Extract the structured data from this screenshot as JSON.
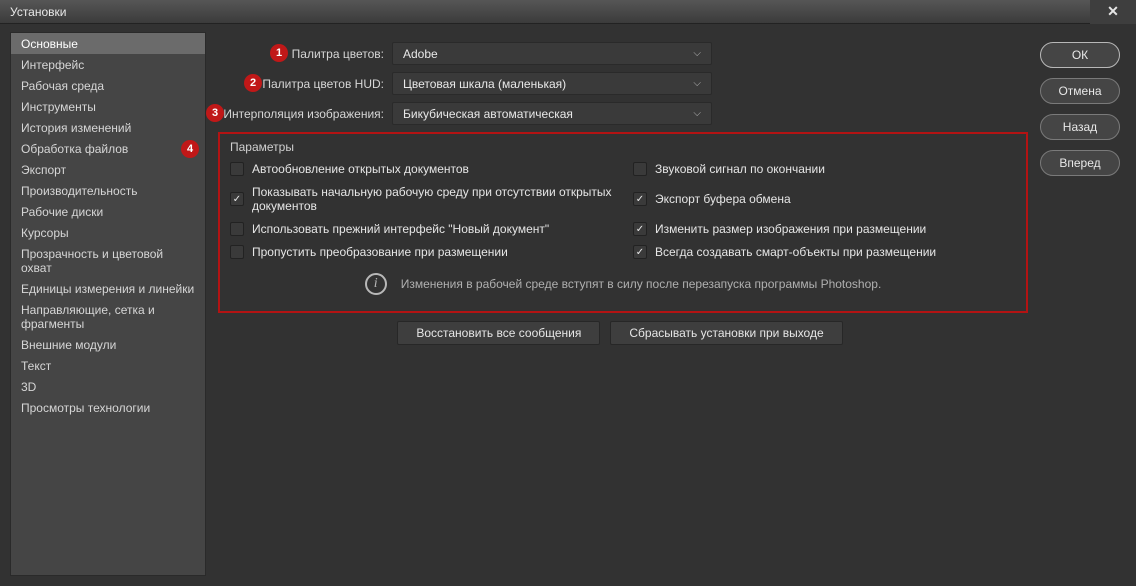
{
  "window": {
    "title": "Установки"
  },
  "sidebar": {
    "items": [
      {
        "label": "Основные",
        "selected": true
      },
      {
        "label": "Интерфейс"
      },
      {
        "label": "Рабочая среда"
      },
      {
        "label": "Инструменты"
      },
      {
        "label": "История изменений"
      },
      {
        "label": "Обработка файлов"
      },
      {
        "label": "Экспорт"
      },
      {
        "label": "Производительность"
      },
      {
        "label": "Рабочие диски"
      },
      {
        "label": "Курсоры"
      },
      {
        "label": "Прозрачность и цветовой охват"
      },
      {
        "label": "Единицы измерения и линейки"
      },
      {
        "label": "Направляющие, сетка и фрагменты"
      },
      {
        "label": "Внешние модули"
      },
      {
        "label": "Текст"
      },
      {
        "label": "3D"
      },
      {
        "label": "Просмотры технологии"
      }
    ]
  },
  "markers": {
    "m1": "1",
    "m2": "2",
    "m3": "3",
    "m4": "4"
  },
  "dropdowns": {
    "color_picker": {
      "label": "Палитра цветов:",
      "value": "Adobe"
    },
    "hud_picker": {
      "label": "Палитра цветов HUD:",
      "value": "Цветовая шкала (маленькая)"
    },
    "interpolation": {
      "label": "Интерполяция изображения:",
      "value": "Бикубическая автоматическая"
    }
  },
  "params": {
    "legend": "Параметры",
    "left": [
      {
        "label": "Автообновление открытых документов",
        "checked": false
      },
      {
        "label": "Показывать начальную рабочую среду при отсутствии открытых документов",
        "checked": true
      },
      {
        "label": "Использовать прежний интерфейс \"Новый документ\"",
        "checked": false
      },
      {
        "label": "Пропустить преобразование при размещении",
        "checked": false
      }
    ],
    "right": [
      {
        "label": "Звуковой сигнал по окончании",
        "checked": false
      },
      {
        "label": "Экспорт буфера обмена",
        "checked": true
      },
      {
        "label": "Изменить размер изображения при размещении",
        "checked": true
      },
      {
        "label": "Всегда создавать смарт-объекты при размещении",
        "checked": true
      }
    ],
    "info": "Изменения в рабочей среде вступят в силу после перезапуска программы Photoshop."
  },
  "buttons": {
    "reset_warnings": "Восстановить все сообщения",
    "reset_on_quit": "Сбрасывать установки при выходе",
    "ok": "ОК",
    "cancel": "Отмена",
    "prev": "Назад",
    "next": "Вперед"
  }
}
